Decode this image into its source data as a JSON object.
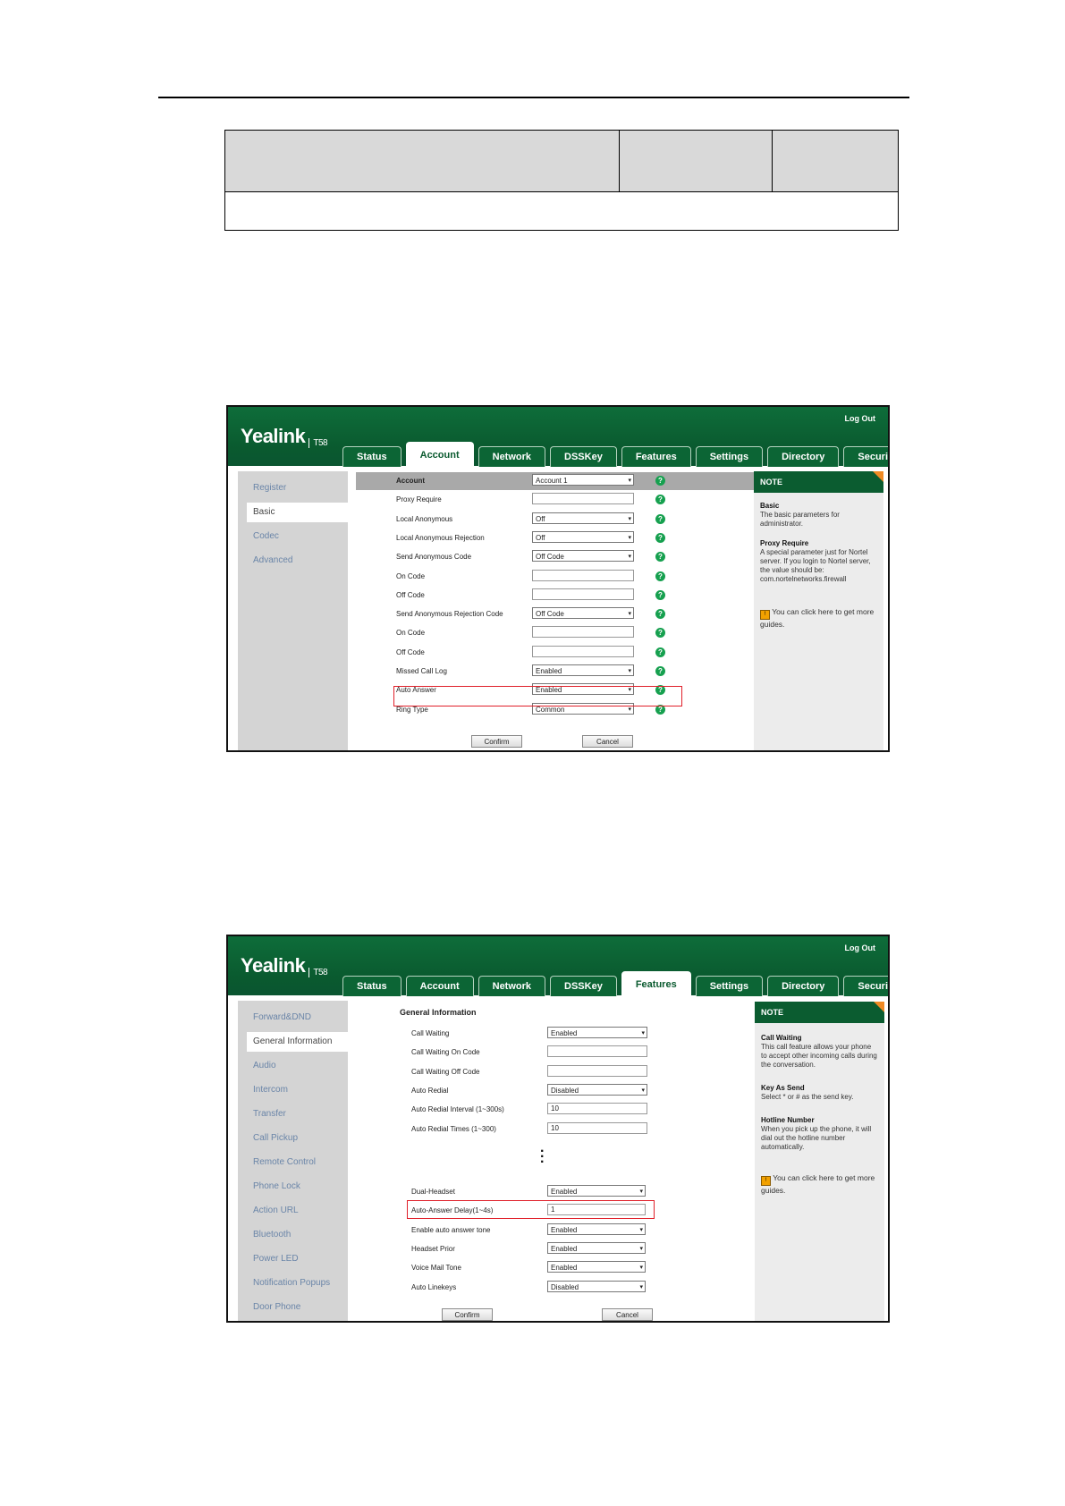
{
  "screen1": {
    "brand": "Yealink",
    "model": "T58",
    "logout": "Log Out",
    "tabs": [
      "Status",
      "Account",
      "Network",
      "DSSKey",
      "Features",
      "Settings",
      "Directory",
      "Security"
    ],
    "active_tab": "Account",
    "sidebar": [
      "Register",
      "Basic",
      "Codec",
      "Advanced"
    ],
    "rows": [
      {
        "label": "Account",
        "type": "select",
        "value": "Account 1"
      },
      {
        "label": "Proxy Require",
        "type": "input",
        "value": ""
      },
      {
        "label": "Local Anonymous",
        "type": "select",
        "value": "Off"
      },
      {
        "label": "Local Anonymous Rejection",
        "type": "select",
        "value": "Off"
      },
      {
        "label": "Send Anonymous Code",
        "type": "select",
        "value": "Off Code"
      },
      {
        "label": "On Code",
        "type": "input",
        "value": ""
      },
      {
        "label": "Off Code",
        "type": "input",
        "value": ""
      },
      {
        "label": "Send Anonymous Rejection Code",
        "type": "select",
        "value": "Off Code"
      },
      {
        "label": "On Code",
        "type": "input",
        "value": ""
      },
      {
        "label": "Off Code",
        "type": "input",
        "value": ""
      },
      {
        "label": "Missed Call Log",
        "type": "select",
        "value": "Enabled"
      },
      {
        "label": "Auto Answer",
        "type": "select",
        "value": "Enabled"
      },
      {
        "label": "Ring Type",
        "type": "select",
        "value": "Common"
      }
    ],
    "confirm": "Confirm",
    "cancel": "Cancel",
    "note": {
      "title": "NOTE",
      "basic_title": "Basic",
      "basic_text": "The basic parameters for administrator.",
      "proxy_title": "Proxy Require",
      "proxy_text": "A special parameter just for Nortel server. If you login to Nortel server, the value should be: com.nortelnetworks.firewall",
      "guide": "You can click here to get more guides."
    }
  },
  "screen2": {
    "brand": "Yealink",
    "model": "T58",
    "logout": "Log Out",
    "tabs": [
      "Status",
      "Account",
      "Network",
      "DSSKey",
      "Features",
      "Settings",
      "Directory",
      "Security"
    ],
    "active_tab": "Features",
    "sidebar": [
      "Forward&DND",
      "General Information",
      "Audio",
      "Intercom",
      "Transfer",
      "Call Pickup",
      "Remote Control",
      "Phone Lock",
      "Action URL",
      "Bluetooth",
      "Power LED",
      "Notification Popups",
      "Door Phone"
    ],
    "section": "General Information",
    "rows_top": [
      {
        "label": "Call Waiting",
        "type": "select",
        "value": "Enabled"
      },
      {
        "label": "Call Waiting On Code",
        "type": "input",
        "value": ""
      },
      {
        "label": "Call Waiting Off Code",
        "type": "input",
        "value": ""
      },
      {
        "label": "Auto Redial",
        "type": "select",
        "value": "Disabled"
      },
      {
        "label": "Auto Redial Interval (1~300s)",
        "type": "input",
        "value": "10"
      },
      {
        "label": "Auto Redial Times (1~300)",
        "type": "input",
        "value": "10"
      }
    ],
    "rows_bottom": [
      {
        "label": "Dual-Headset",
        "type": "select",
        "value": "Enabled"
      },
      {
        "label": "Auto-Answer Delay(1~4s)",
        "type": "input",
        "value": "1"
      },
      {
        "label": "Enable auto answer tone",
        "type": "select",
        "value": "Enabled"
      },
      {
        "label": "Headset Prior",
        "type": "select",
        "value": "Enabled"
      },
      {
        "label": "Voice Mail Tone",
        "type": "select",
        "value": "Enabled"
      },
      {
        "label": "Auto Linekeys",
        "type": "select",
        "value": "Disabled"
      }
    ],
    "confirm": "Confirm",
    "cancel": "Cancel",
    "note": {
      "title": "NOTE",
      "cw_title": "Call Waiting",
      "cw_text": "This call feature allows your phone to accept other incoming calls during the conversation.",
      "kas_title": "Key As Send",
      "kas_text": "Select * or # as the send key.",
      "hn_title": "Hotline Number",
      "hn_text": "When you pick up the phone, it will dial out the hotline number automatically.",
      "guide": "You can click here to get more guides."
    }
  }
}
